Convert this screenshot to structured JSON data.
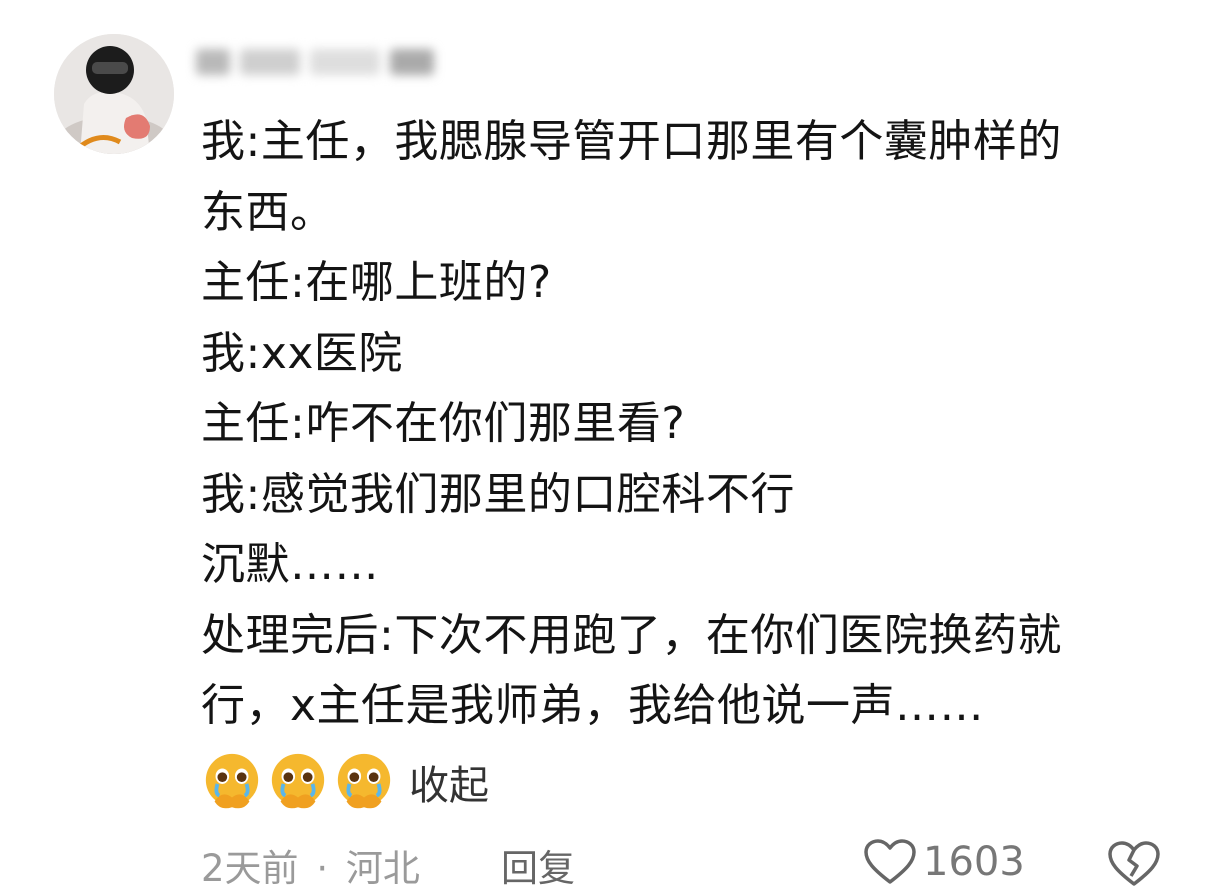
{
  "comment": {
    "lines": [
      "我:主任，我腮腺导管开口那里有个囊肿样的",
      "东西。",
      "主任:在哪上班的?",
      "我:xx医院",
      "主任:咋不在你们那里看?",
      "我:感觉我们那里的口腔科不行",
      "沉默……",
      "处理完后:下次不用跑了，在你们医院换药就",
      "行，x主任是我师弟，我给他说一声……"
    ],
    "emojis": [
      "crying-face-hands-emoji",
      "crying-face-hands-emoji",
      "crying-face-hands-emoji"
    ],
    "collapse_label": "收起"
  },
  "footer": {
    "time": "2天前",
    "separator": "·",
    "location": "河北",
    "reply_label": "回复",
    "like_count": "1603"
  },
  "icons": {
    "like": "heart-outline-icon",
    "dislike": "broken-heart-icon"
  },
  "colors": {
    "text": "#141414",
    "meta": "#9a9a9a",
    "emoji": "#f5b82e"
  }
}
